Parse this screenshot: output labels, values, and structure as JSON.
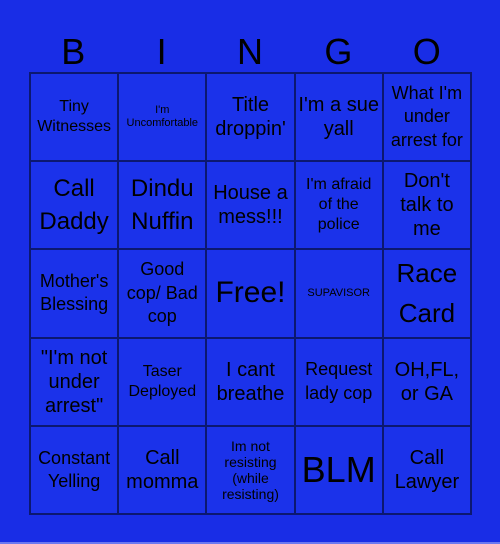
{
  "title_letters": [
    "B",
    "I",
    "N",
    "G",
    "O"
  ],
  "colors": {
    "background": "#192de6",
    "cell": "#1b32ea",
    "border": "#0c1870",
    "text": "#000000"
  },
  "board": {
    "rows": [
      [
        "Tiny Witnesses",
        "I'm Uncomfortable",
        "Title droppin'",
        "I'm a sue yall",
        "What I'm under arrest for"
      ],
      [
        "Call Daddy",
        "Dindu Nuffin",
        "House a mess!!!",
        "I'm afraid of the police",
        "Don't talk to me"
      ],
      [
        "Mother's Blessing",
        "Good cop/ Bad cop",
        "Free!",
        "SUPAVISOR",
        "Race Card"
      ],
      [
        "\"I'm not under arrest\"",
        "Taser Deployed",
        "I cant breathe",
        "Request lady cop",
        "OH,FL, or GA"
      ],
      [
        "Constant Yelling",
        "Call momma",
        "Im not resisting (while resisting)",
        "BLM",
        "Call Lawyer"
      ]
    ]
  }
}
